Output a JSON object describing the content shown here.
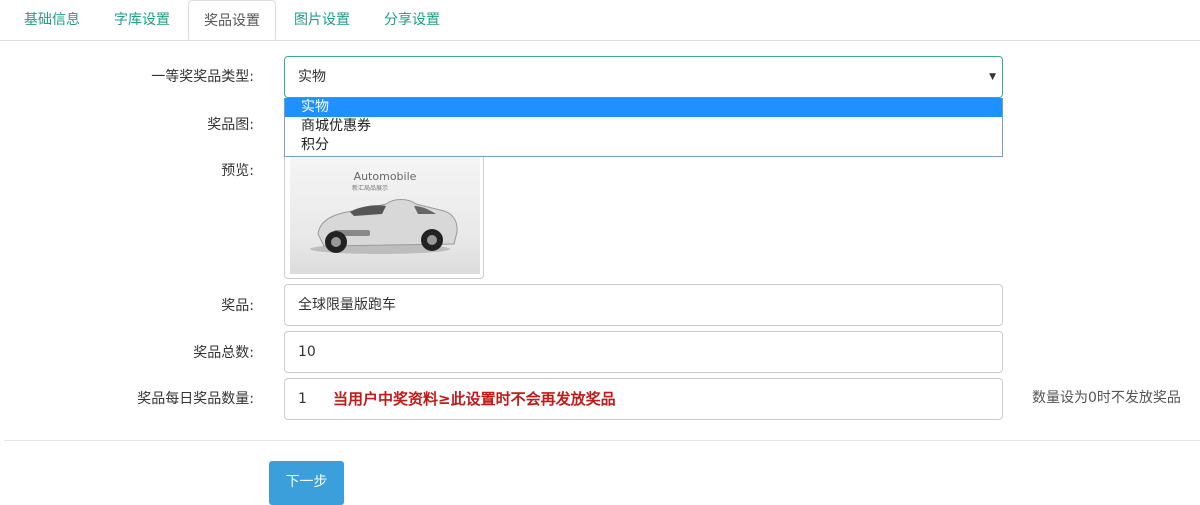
{
  "tabs": [
    "基础信息",
    "字库设置",
    "奖品设置",
    "图片设置",
    "分享设置"
  ],
  "active_tab": "奖品设置",
  "form": {
    "prize_type_label": "一等奖奖品类型:",
    "prize_type_value": "实物",
    "prize_type_options": [
      "实物",
      "商城优惠券",
      "积分"
    ],
    "prize_image_label": "奖品图:",
    "preview_label": "预览:",
    "preview_image_text": "Automobile",
    "preview_image_subtext": "新汇局品展示",
    "prize_label": "奖品:",
    "prize_value": "全球限量版跑车",
    "total_label": "奖品总数:",
    "total_value": "10",
    "daily_label": "奖品每日奖品数量:",
    "daily_value": "1",
    "daily_note": "当用户中奖资料≥此设置时不会再发放奖品",
    "daily_help": "数量设为0时不发放奖品"
  },
  "next_button": "下一步",
  "colors": {
    "tab_text": "#1f9e86",
    "note_text": "#c11a1a",
    "button_bg": "#3b9fdb",
    "option_selected": "#1e90ff"
  }
}
